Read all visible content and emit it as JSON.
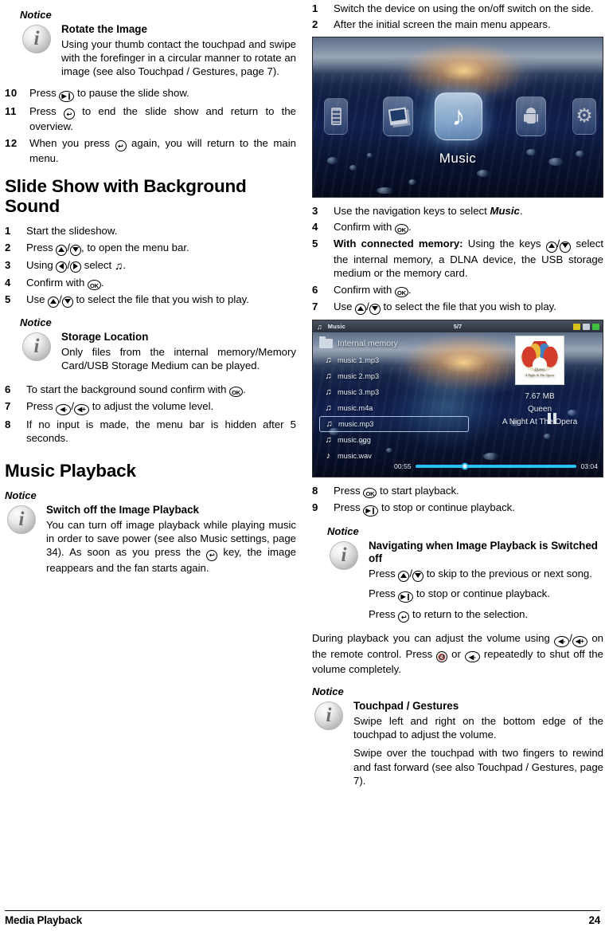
{
  "footer": {
    "section": "Media Playback",
    "page": "24"
  },
  "left": {
    "notice_rotate": {
      "label": "Notice",
      "title": "Rotate the Image",
      "text": "Using your thumb contact the touchpad and swipe with the forefinger in a circular manner to rotate an image (see also Touchpad / Gestures, page 7)."
    },
    "steps_slideshow": [
      {
        "num": "10",
        "pre": "Press ",
        "key": "play-pause",
        "post": " to pause the slide show."
      },
      {
        "num": "11",
        "pre": "Press ",
        "key": "return",
        "post": " to end the slide show and return to the overview."
      },
      {
        "num": "12",
        "pre": "When you press ",
        "key": "return",
        "post": " again, you will return to the main menu."
      }
    ],
    "heading_slideshow": "Slide Show with Background Sound",
    "steps_bgsound": [
      {
        "num": "1",
        "text": "Start the slideshow."
      },
      {
        "num": "2",
        "pre": "Press ",
        "post": ", to open the menu bar."
      },
      {
        "num": "3",
        "pre": "Using ",
        "post": " select "
      },
      {
        "num": "4",
        "pre": "Confirm with ",
        "post": "."
      },
      {
        "num": "5",
        "pre": "Use ",
        "post": " to select the file that you wish to play."
      }
    ],
    "notice_storage": {
      "label": "Notice",
      "title": "Storage Location",
      "text": "Only files from the internal memory/Memory Card/USB Storage Medium can be played."
    },
    "steps_bgsound2": [
      {
        "num": "6",
        "pre": "To start the background sound confirm with ",
        "post": "."
      },
      {
        "num": "7",
        "pre": "Press ",
        "post": " to adjust the volume level."
      },
      {
        "num": "8",
        "text": "If no input is made, the menu bar is hidden after 5 seconds."
      }
    ],
    "heading_music": "Music Playback",
    "notice_switchoff": {
      "label": "Notice",
      "title": "Switch off the Image Playback",
      "text_a": "You can turn off image playback while playing music in order to save power (see also Music settings, page 34). As soon as you press the ",
      "text_b": " key, the image reappears and the fan starts again."
    }
  },
  "right": {
    "steps_a": [
      {
        "num": "1",
        "text": "Switch the device on using the on/off switch on the side."
      },
      {
        "num": "2",
        "text": "After the initial screen the main menu appears."
      }
    ],
    "steps_b": [
      {
        "num": "3",
        "pre": "Use the navigation keys to select ",
        "bold": "Music",
        "post": "."
      },
      {
        "num": "4",
        "pre": "Confirm with ",
        "post": "."
      },
      {
        "num": "5",
        "bold": "With connected memory:",
        "pre": " Using the keys ",
        "post": " select the internal memory, a DLNA device, the USB storage medium or the memory card."
      },
      {
        "num": "6",
        "pre": "Confirm with ",
        "post": "."
      },
      {
        "num": "7",
        "pre": "Use ",
        "post": " to select the file that you wish to play."
      }
    ],
    "steps_c": [
      {
        "num": "8",
        "pre": "Press ",
        "post": " to start playback."
      },
      {
        "num": "9",
        "pre": "Press ",
        "post": " to stop or continue playback."
      }
    ],
    "notice_navigating": {
      "label": "Notice",
      "title": "Navigating when Image Playback is Switched off",
      "line1_pre": "Press ",
      "line1_post": " to skip to the previous or next song.",
      "line2_pre": "Press ",
      "line2_post": " to stop or continue playback.",
      "line3_pre": "Press ",
      "line3_post": " to return to the selection."
    },
    "volume_para": {
      "pre": "During playback you can adjust the volume using ",
      "mid": " on the remote control. Press ",
      "mid2": " or ",
      "post": " repeatedly to shut off the volume completely."
    },
    "notice_touchpad": {
      "label": "Notice",
      "title": "Touchpad / Gestures",
      "text_a": "Swipe left and right on the bottom edge of the touchpad to adjust the volume.",
      "text_b": "Swipe over the touchpad with two fingers to rewind and fast forward (see also Touchpad / Gestures, page 7)."
    },
    "main_menu_screen": {
      "selected_label": "Music",
      "tiles": [
        "video-tile",
        "photo-tile",
        "music-tile",
        "android-tile",
        "settings-tile"
      ]
    },
    "music_screen": {
      "title": "Music",
      "counter": "5/7",
      "folder": "Internal memory",
      "files": [
        "music 1.mp3",
        "music 2.mp3",
        "music 3.mp3",
        "music.m4a",
        "music.mp3",
        "music.ogg",
        "music.wav"
      ],
      "selected_file": "music.mp3",
      "filesize": "7.67 MB",
      "artist": "Queen",
      "album": "A Night At The Opera",
      "cover_line1": "Queen",
      "cover_line2": "A Night At The Opera",
      "elapsed": "00:55",
      "duration": "03:04"
    }
  }
}
